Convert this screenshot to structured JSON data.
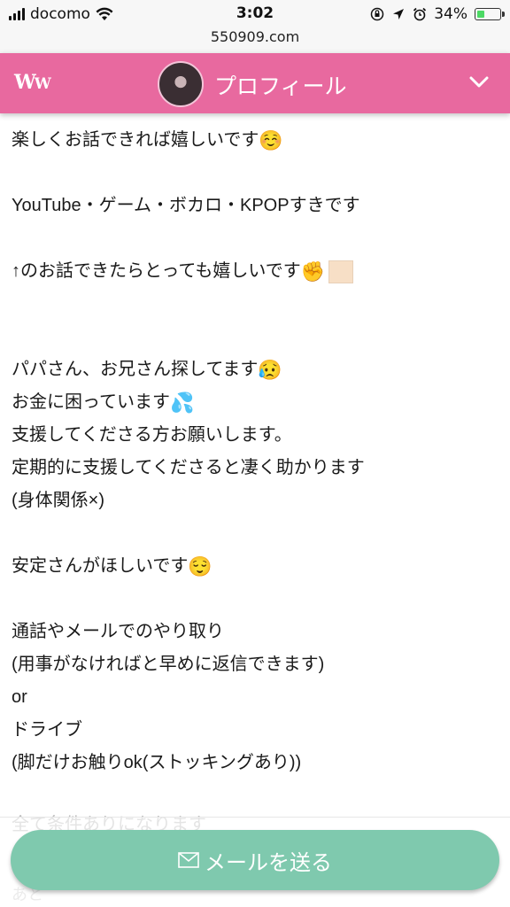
{
  "status_bar": {
    "carrier": "docomo",
    "time": "3:02",
    "battery_percent_text": "34%",
    "battery_level": 0.34
  },
  "url_bar": {
    "url": "550909.com"
  },
  "header": {
    "logo": "WW",
    "title": "プロフィール",
    "color": "#e8699f"
  },
  "profile_text": {
    "line1": "楽しくお話できれば嬉しいです",
    "line1_emoji": "☺️",
    "line2": "YouTube・ゲーム・ボカロ・KPOPすきです",
    "line3": "↑のお話できたらとっても嬉しいです",
    "line3_emoji": "✊",
    "line4": "パパさん、お兄さん探してます",
    "line4_emoji": "😥",
    "line5": "お金に困っています",
    "line5_emoji": "💦",
    "line6": "支援してくださる方お願いします。",
    "line7": "定期的に支援してくださると凄く助かります",
    "line8": "(身体関係×)",
    "line9": "安定さんがほしいです",
    "line9_emoji": "😌",
    "line10": "通話やメールでのやり取り",
    "line11": "(用事がなければと早めに返信できます)",
    "line12": "or",
    "line13": "ドライブ",
    "line14": "(脚だけお触りok(ストッキングあり))",
    "line15_partial": "全て条件ありになります",
    "line16_partial": "あと"
  },
  "send_mail_button": {
    "label": "メールを送る",
    "color": "#7fc9ae"
  }
}
